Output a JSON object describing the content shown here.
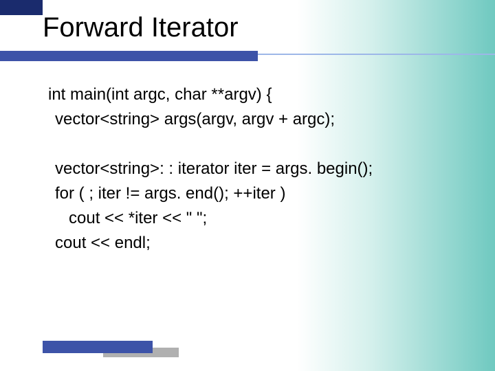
{
  "title": "Forward Iterator",
  "code": {
    "line1": "int main(int argc, char **argv) {",
    "line2": "vector<string> args(argv, argv + argc);",
    "line3": "vector<string>: : iterator iter = args. begin();",
    "line4": "for ( ; iter != args. end(); ++iter )",
    "line5": "cout << *iter << \" \";",
    "line6": "cout << endl;"
  }
}
